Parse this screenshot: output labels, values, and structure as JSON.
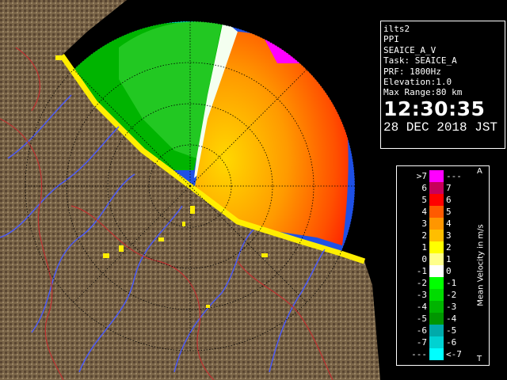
{
  "info": {
    "radar_name": "ilts2",
    "scan_mode": "PPI",
    "product": "SEAICE_A_V",
    "task": "Task: SEAICE_A",
    "prf": "PRF: 1800Hz",
    "elevation": "Elevation:1.0",
    "max_range": "Max Range:80 km",
    "time": "12:30:35",
    "date": "28 DEC 2018 JST"
  },
  "legend": {
    "title": "Mean Velocity in m/s",
    "top_mark": "A",
    "bottom_mark": "T",
    "rows": [
      {
        "left": ">7",
        "color": "#ff00ff",
        "right": "---"
      },
      {
        "left": "6",
        "color": "#c8005a",
        "right": "7"
      },
      {
        "left": "5",
        "color": "#ff0000",
        "right": "6"
      },
      {
        "left": "4",
        "color": "#ff5a00",
        "right": "5"
      },
      {
        "left": "3",
        "color": "#ff9600",
        "right": "4"
      },
      {
        "left": "2",
        "color": "#ffbe00",
        "right": "3"
      },
      {
        "left": "1",
        "color": "#ffff00",
        "right": "2"
      },
      {
        "left": "0",
        "color": "#ffff8c",
        "right": "1"
      },
      {
        "left": "-1",
        "color": "#ffffff",
        "right": "0"
      },
      {
        "left": "-2",
        "color": "#00ff00",
        "right": "-1"
      },
      {
        "left": "-3",
        "color": "#00dc00",
        "right": "-2"
      },
      {
        "left": "-4",
        "color": "#00b400",
        "right": "-3"
      },
      {
        "left": "-5",
        "color": "#009600",
        "right": "-4"
      },
      {
        "left": "-6",
        "color": "#00aaaa",
        "right": "-5"
      },
      {
        "left": "-7",
        "color": "#00d2d2",
        "right": "-6"
      },
      {
        "left": "---",
        "color": "#00ffff",
        "right": "<-7"
      }
    ]
  },
  "map_colors": {
    "radar_background": "#1e50e6",
    "terrain": "#7a6548",
    "terrain_dark": "#4a3a28",
    "rivers": "#4a5aff",
    "borders": "#c03030",
    "range_rings": "#000000"
  }
}
